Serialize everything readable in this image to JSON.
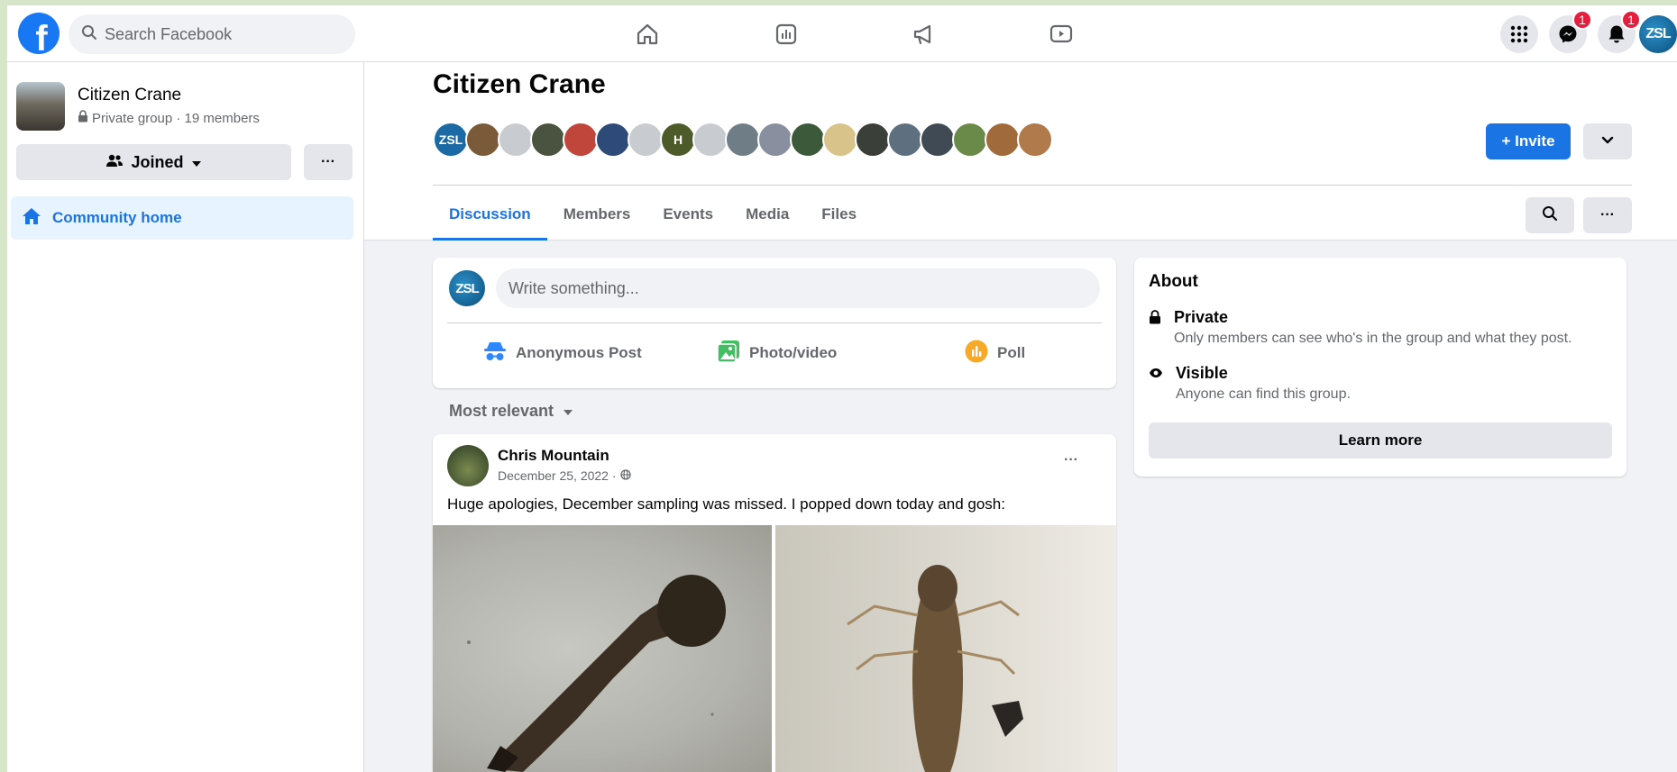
{
  "topbar": {
    "search_placeholder": "Search Facebook",
    "messenger_badge": "1",
    "notifications_badge": "1",
    "profile_initials": "ZSL"
  },
  "sidebar": {
    "group_name": "Citizen Crane",
    "group_meta": "Private group · 19 members",
    "joined_label": "Joined",
    "more_label": "···",
    "nav_items": [
      {
        "label": "Community home",
        "icon": "home-icon",
        "active": true
      }
    ]
  },
  "group": {
    "title": "Citizen Crane",
    "invite_label": "+ Invite",
    "member_avatars": [
      {
        "initials": "ZSL",
        "color": "#1b6aa5"
      },
      {
        "initials": "",
        "color": "#7b5a3a"
      },
      {
        "initials": "",
        "color": "#c8ccd1"
      },
      {
        "initials": "",
        "color": "#4a5240"
      },
      {
        "initials": "",
        "color": "#c0453a"
      },
      {
        "initials": "",
        "color": "#2d4a78"
      },
      {
        "initials": "",
        "color": "#c8ccd1"
      },
      {
        "initials": "H",
        "color": "#4d5a2a"
      },
      {
        "initials": "",
        "color": "#c8ccd1"
      },
      {
        "initials": "",
        "color": "#6e7d86"
      },
      {
        "initials": "",
        "color": "#8a8fa0"
      },
      {
        "initials": "",
        "color": "#3c5a3a"
      },
      {
        "initials": "",
        "color": "#d8c48a"
      },
      {
        "initials": "",
        "color": "#3a3f3a"
      },
      {
        "initials": "",
        "color": "#5e7080"
      },
      {
        "initials": "",
        "color": "#404a55"
      },
      {
        "initials": "",
        "color": "#6a8a4a"
      },
      {
        "initials": "",
        "color": "#a06a3a"
      },
      {
        "initials": "",
        "color": "#b07a4a"
      }
    ],
    "tabs": [
      "Discussion",
      "Members",
      "Events",
      "Media",
      "Files"
    ],
    "active_tab": "Discussion"
  },
  "composer": {
    "avatar_initials": "ZSL",
    "placeholder": "Write something...",
    "actions": [
      {
        "label": "Anonymous Post",
        "icon": "anonymous-icon",
        "color": "#2d88ff"
      },
      {
        "label": "Photo/video",
        "icon": "photo-icon",
        "color": "#45bd62"
      },
      {
        "label": "Poll",
        "icon": "poll-icon",
        "color": "#f7b928"
      }
    ]
  },
  "feed": {
    "sort_label": "Most relevant"
  },
  "post": {
    "author": "Chris Mountain",
    "date": "December 25, 2022 ·",
    "text": "Huge apologies, December sampling was missed. I popped down today and gosh:",
    "menu": "···"
  },
  "about": {
    "title": "About",
    "items": [
      {
        "heading": "Private",
        "desc": "Only members can see who's in the group and what they post.",
        "icon": "lock-icon"
      },
      {
        "heading": "Visible",
        "desc": "Anyone can find this group.",
        "icon": "eye-icon"
      }
    ],
    "learn_more": "Learn more"
  },
  "colors": {
    "brand": "#1877f2",
    "accent": "#1b74e4",
    "badge": "#e41e3f"
  }
}
